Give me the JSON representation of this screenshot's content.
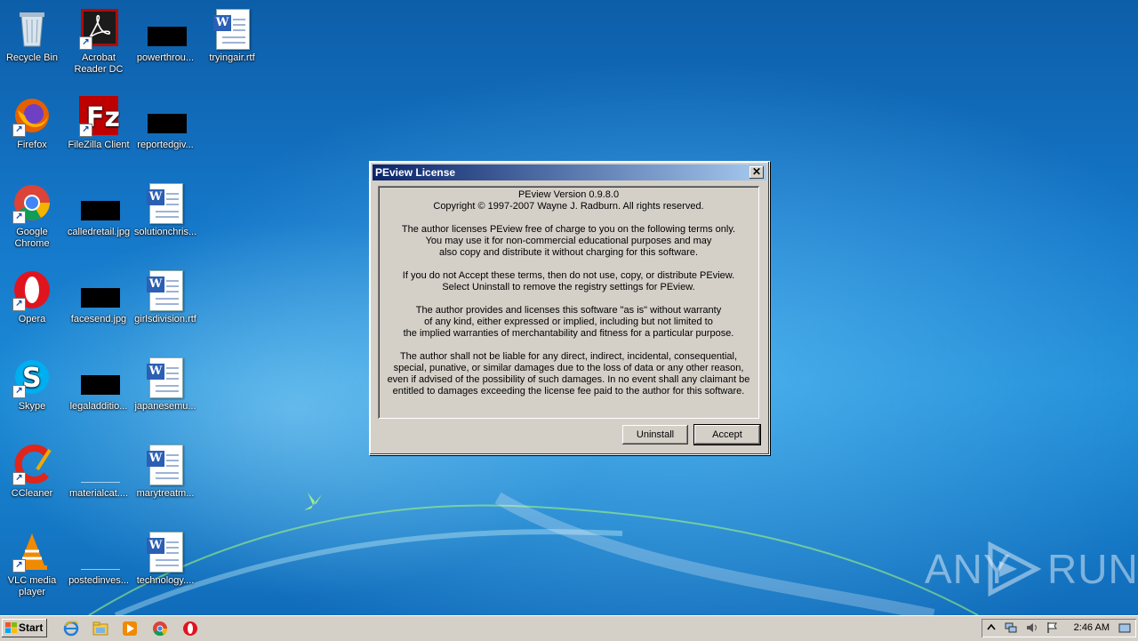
{
  "desktop": {
    "icons": [
      {
        "label": "Recycle Bin",
        "icon": "recycle-bin-icon"
      },
      {
        "label": "Acrobat Reader DC",
        "icon": "acrobat-reader-icon"
      },
      {
        "label": "powerthrou...",
        "icon": "image-file-icon"
      },
      {
        "label": "tryingair.rtf",
        "icon": "word-document-icon"
      },
      {
        "label": "Firefox",
        "icon": "firefox-icon"
      },
      {
        "label": "FileZilla Client",
        "icon": "filezilla-icon"
      },
      {
        "label": "reportedgiv...",
        "icon": "image-file-icon"
      },
      {
        "label": "Google Chrome",
        "icon": "chrome-icon"
      },
      {
        "label": "calledretail.jpg",
        "icon": "image-file-icon"
      },
      {
        "label": "solutionchris...",
        "icon": "word-document-icon"
      },
      {
        "label": "Opera",
        "icon": "opera-icon"
      },
      {
        "label": "facesend.jpg",
        "icon": "image-file-icon"
      },
      {
        "label": "girlsdivision.rtf",
        "icon": "word-document-icon"
      },
      {
        "label": "Skype",
        "icon": "skype-icon"
      },
      {
        "label": "legaladditio...",
        "icon": "image-file-icon"
      },
      {
        "label": "japanesemu...",
        "icon": "word-document-icon"
      },
      {
        "label": "CCleaner",
        "icon": "ccleaner-icon"
      },
      {
        "label": "materialcat....",
        "icon": "image-file-icon"
      },
      {
        "label": "marytreatm...",
        "icon": "word-document-icon"
      },
      {
        "label": "VLC media player",
        "icon": "vlc-icon"
      },
      {
        "label": "postedinves...",
        "icon": "image-file-icon"
      },
      {
        "label": "technology....",
        "icon": "word-document-icon"
      }
    ]
  },
  "dialog": {
    "title": "PEview License",
    "close_glyph": "✕",
    "paragraphs": [
      [
        "PEview Version 0.9.8.0",
        "Copyright © 1997-2007 Wayne J. Radburn. All rights reserved."
      ],
      [
        "The author licenses PEview free of charge to you on the following terms only.",
        "You may use it for non-commercial educational purposes and may",
        "also copy and distribute it without charging for this software."
      ],
      [
        "If you do not Accept these terms, then do not use, copy, or distribute PEview.",
        "Select Uninstall to remove the registry settings for PEview."
      ],
      [
        "The author provides and licenses this software \"as is\" without warranty",
        "of any kind, either expressed or implied, including but not limited to",
        "the implied warranties of merchantability and fitness for a particular purpose."
      ],
      [
        "The author shall not be liable for any direct, indirect, incidental, consequential,",
        "special, punative, or similar damages due to the loss of data or any other reason,",
        "even if advised of the possibility of such damages. In no event shall any claimant be",
        "entitled to damages exceeding the license fee paid to the author for this software."
      ]
    ],
    "buttons": {
      "uninstall": "Uninstall",
      "accept": "Accept"
    }
  },
  "taskbar": {
    "start_label": "Start",
    "pinned": [
      "internet-explorer-icon",
      "file-explorer-icon",
      "media-player-icon",
      "chrome-icon",
      "opera-icon"
    ],
    "clock": "2:46 AM"
  },
  "watermark": {
    "left": "ANY",
    "right": "RUN"
  },
  "colors": {
    "titlebar_start": "#0a246a",
    "titlebar_end": "#a6caf0",
    "dialog_bg": "#d4d0c8"
  }
}
